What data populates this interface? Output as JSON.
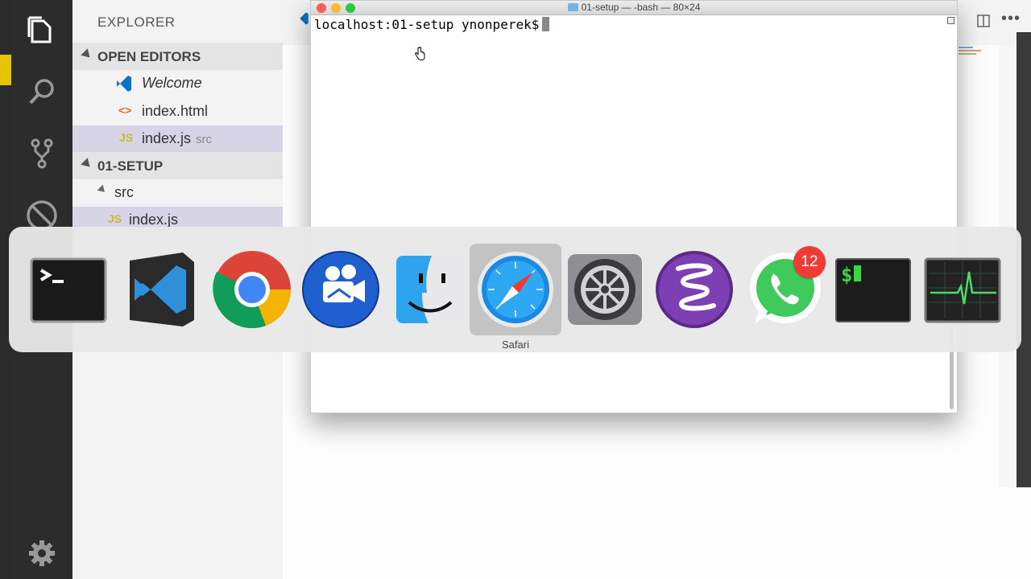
{
  "explorer": {
    "title": "EXPLORER",
    "open_editors": {
      "header": "OPEN EDITORS",
      "items": [
        {
          "icon": "vscode-icon",
          "label": "Welcome"
        },
        {
          "icon": "html-icon",
          "label": "index.html"
        },
        {
          "icon": "js-icon",
          "label": "index.js",
          "sub": "src"
        }
      ]
    },
    "project": {
      "header": "01-SETUP",
      "folder": "src",
      "file": "index.js"
    }
  },
  "terminal": {
    "title": "01-setup — -bash — 80×24",
    "prompt": "localhost:01-setup ynonperek$"
  },
  "switcher": {
    "selected_label": "Safari",
    "apps": [
      {
        "name": "terminal-app"
      },
      {
        "name": "vscode-app"
      },
      {
        "name": "chrome-app"
      },
      {
        "name": "screenflow-app"
      },
      {
        "name": "finder-app"
      },
      {
        "name": "safari-app"
      },
      {
        "name": "system-preferences-app"
      },
      {
        "name": "emacs-app"
      },
      {
        "name": "whatsapp-app",
        "badge": "12"
      },
      {
        "name": "iterm-app"
      },
      {
        "name": "activity-monitor-app"
      }
    ]
  },
  "colors": {
    "activity_bar": "#2c2c2c",
    "sidebar": "#f3f3f3",
    "selection": "#d6d4e6",
    "badge": "#f03b35"
  }
}
